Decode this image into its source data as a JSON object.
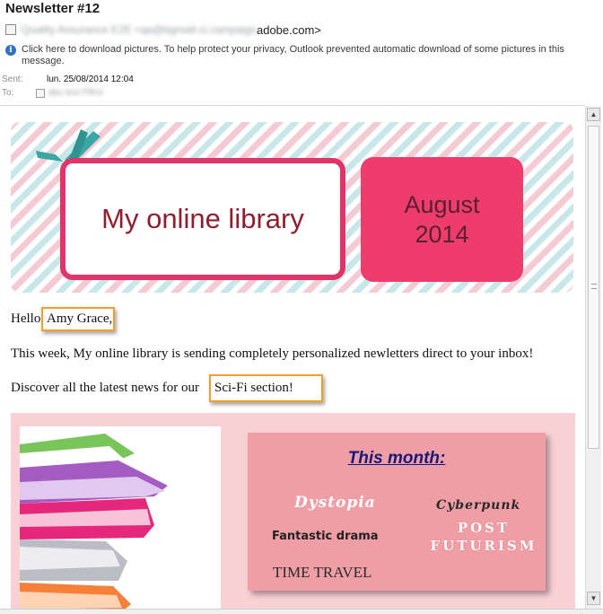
{
  "header": {
    "title": "Newsletter #12",
    "from_blurred": "Quality Assurance E2E <qa@bgmail-ci.campaign",
    "from_domain": "adobe.com>",
    "info_text": "Click here to download pictures. To help protect your privacy, Outlook prevented automatic download of some pictures in this message.",
    "sent_label": "Sent:",
    "sent_value": "lun. 25/08/2014 12:04",
    "to_label": "To:",
    "to_blurred": "abc.test Plfrst"
  },
  "banner": {
    "title": "My online library",
    "month": "August",
    "year": "2014"
  },
  "body": {
    "greeting_prefix": "Hello",
    "recipient_name": "Amy Grace,",
    "intro": "This week, My online library is sending completely personalized newletters direct to your inbox!",
    "discover_prefix": "Discover all the latest news for our",
    "section_name": "Sci-Fi section!"
  },
  "promo": {
    "heading": "This month:",
    "genres": {
      "dystopia": "Dystopia",
      "cyberpunk": "Cyberpunk",
      "fantastic_drama": "Fantastic drama",
      "post_futurism_1": "POST",
      "post_futurism_2": "FUTURISM",
      "time_travel": "TIME TRAVEL"
    }
  },
  "colors": {
    "accent_pink": "#ee3c6d",
    "highlight_orange": "#f0a02a",
    "title_red": "#8f1f2e"
  }
}
